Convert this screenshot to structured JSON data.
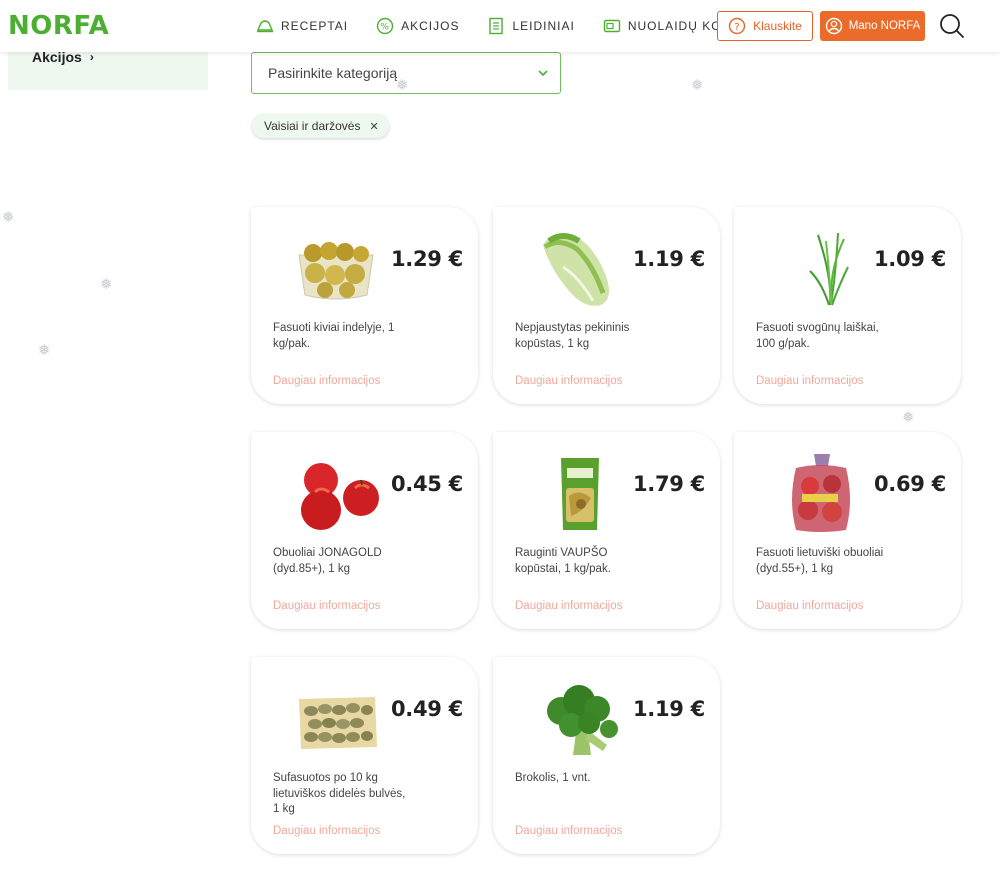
{
  "header": {
    "logo": "NORFA",
    "nav": [
      {
        "label": "RECEPTAI",
        "icon": "recipe-hat-icon"
      },
      {
        "label": "AKCIJOS",
        "icon": "percent-icon"
      },
      {
        "label": "LEIDINIAI",
        "icon": "leaflet-icon"
      },
      {
        "label": "NUOLAIDŲ KORTELĖ",
        "icon": "discount-card-icon"
      }
    ],
    "ask_label": "Klauskite",
    "account_label": "Mano NORFA"
  },
  "sidebar": {
    "link_label": "Akcijos"
  },
  "filter": {
    "select_placeholder": "Pasirinkite kategoriją",
    "chip_label": "Vaisiai ir daržovės"
  },
  "products": [
    {
      "price": "1.29 €",
      "name": "Fasuoti kiviai indelyje, 1 kg/pak.",
      "more": "Daugiau informacijos",
      "image": "kiwi-tray-image"
    },
    {
      "price": "1.19 €",
      "name": "Nepjaustytas pekininis kopūstas, 1 kg",
      "more": "Daugiau informacijos",
      "image": "chinese-cabbage-image"
    },
    {
      "price": "1.09 €",
      "name": "Fasuoti svogūnų laiškai, 100 g/pak.",
      "more": "Daugiau informacijos",
      "image": "green-onion-image"
    },
    {
      "price": "0.45 €",
      "name": "Obuoliai JONAGOLD (dyd.85+), 1 kg",
      "more": "Daugiau informacijos",
      "image": "red-apples-image"
    },
    {
      "price": "1.79 €",
      "name": "Rauginti VAUPŠO kopūstai, 1 kg/pak.",
      "more": "Daugiau informacijos",
      "image": "sauerkraut-pack-image"
    },
    {
      "price": "0.69 €",
      "name": "Fasuoti lietuviški obuoliai (dyd.55+), 1 kg",
      "more": "Daugiau informacijos",
      "image": "bagged-apples-image"
    },
    {
      "price": "0.49 €",
      "name": "Sufasuotos po 10 kg lietuviškos didelės bulvės, 1 kg",
      "more": "Daugiau informacijos",
      "image": "potato-sack-image"
    },
    {
      "price": "1.19 €",
      "name": "Brokolis, 1 vnt.",
      "more": "Daugiau informacijos",
      "image": "broccoli-image"
    }
  ],
  "colors": {
    "brand_green": "#4caf32",
    "accent_orange": "#ea6b2a",
    "link_pink": "#f0a89c",
    "chip_bg": "#eef8ef"
  }
}
